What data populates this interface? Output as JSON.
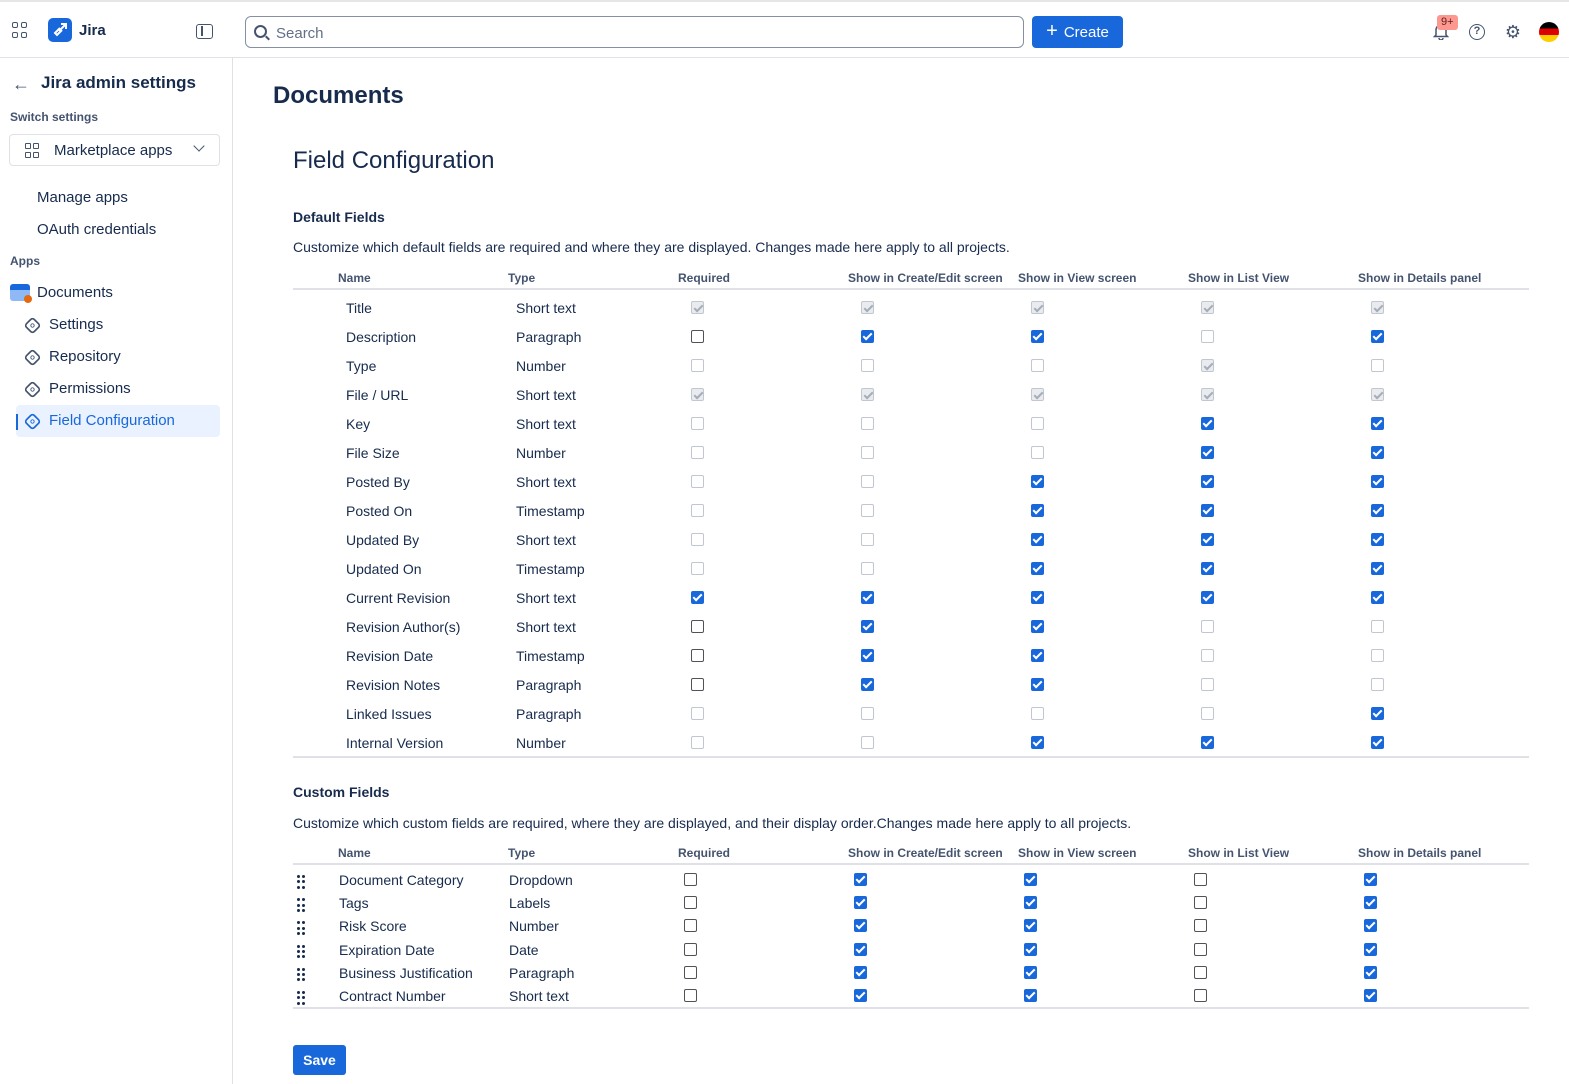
{
  "topbar": {
    "brand": "Jira",
    "search_placeholder": "Search",
    "create_label": "Create",
    "notifications_badge": "9+"
  },
  "sidebar": {
    "title": "Jira admin settings",
    "switch_label": "Switch settings",
    "switch_value": "Marketplace apps",
    "links": [
      "Manage apps",
      "OAuth credentials"
    ],
    "apps_label": "Apps",
    "app_name": "Documents",
    "app_items": [
      "Settings",
      "Repository",
      "Permissions",
      "Field Configuration"
    ],
    "active_item": "Field Configuration"
  },
  "main": {
    "page_title": "Documents",
    "section_title": "Field Configuration",
    "columns": [
      "Name",
      "Type",
      "Required",
      "Show in Create/Edit screen",
      "Show in View screen",
      "Show in List View",
      "Show in Details panel"
    ],
    "default_fields": {
      "title": "Default Fields",
      "description": "Customize which default fields are required and where they are displayed. Changes made here apply to all projects.",
      "rows": [
        {
          "name": "Title",
          "type": "Short text",
          "flags": [
            "dc",
            "dc",
            "dc",
            "dc",
            "dc"
          ]
        },
        {
          "name": "Description",
          "type": "Paragraph",
          "flags": [
            "u",
            "c",
            "c",
            "du",
            "c"
          ]
        },
        {
          "name": "Type",
          "type": "Number",
          "flags": [
            "du",
            "du",
            "du",
            "dc",
            "du"
          ]
        },
        {
          "name": "File / URL",
          "type": "Short text",
          "flags": [
            "dc",
            "dc",
            "dc",
            "dc",
            "dc"
          ]
        },
        {
          "name": "Key",
          "type": "Short text",
          "flags": [
            "du",
            "du",
            "du",
            "c",
            "c"
          ]
        },
        {
          "name": "File Size",
          "type": "Number",
          "flags": [
            "du",
            "du",
            "du",
            "c",
            "c"
          ]
        },
        {
          "name": "Posted By",
          "type": "Short text",
          "flags": [
            "du",
            "du",
            "c",
            "c",
            "c"
          ]
        },
        {
          "name": "Posted On",
          "type": "Timestamp",
          "flags": [
            "du",
            "du",
            "c",
            "c",
            "c"
          ]
        },
        {
          "name": "Updated By",
          "type": "Short text",
          "flags": [
            "du",
            "du",
            "c",
            "c",
            "c"
          ]
        },
        {
          "name": "Updated On",
          "type": "Timestamp",
          "flags": [
            "du",
            "du",
            "c",
            "c",
            "c"
          ]
        },
        {
          "name": "Current Revision",
          "type": "Short text",
          "flags": [
            "c",
            "c",
            "c",
            "c",
            "c"
          ]
        },
        {
          "name": "Revision Author(s)",
          "type": "Short text",
          "flags": [
            "u",
            "c",
            "c",
            "du",
            "du"
          ]
        },
        {
          "name": "Revision Date",
          "type": "Timestamp",
          "flags": [
            "u",
            "c",
            "c",
            "du",
            "du"
          ]
        },
        {
          "name": "Revision Notes",
          "type": "Paragraph",
          "flags": [
            "u",
            "c",
            "c",
            "du",
            "du"
          ]
        },
        {
          "name": "Linked Issues",
          "type": "Paragraph",
          "flags": [
            "du",
            "du",
            "du",
            "du",
            "c"
          ]
        },
        {
          "name": "Internal Version",
          "type": "Number",
          "flags": [
            "du",
            "du",
            "c",
            "c",
            "c"
          ]
        }
      ]
    },
    "custom_fields": {
      "title": "Custom Fields",
      "description": "Customize which custom fields are required, where they are displayed, and their display order.Changes made here apply to all projects.",
      "rows": [
        {
          "name": "Document Category",
          "type": "Dropdown",
          "flags": [
            "u",
            "c",
            "c",
            "u",
            "c"
          ]
        },
        {
          "name": "Tags",
          "type": "Labels",
          "flags": [
            "u",
            "c",
            "c",
            "u",
            "c"
          ]
        },
        {
          "name": "Risk Score",
          "type": "Number",
          "flags": [
            "u",
            "c",
            "c",
            "u",
            "c"
          ]
        },
        {
          "name": "Expiration Date",
          "type": "Date",
          "flags": [
            "u",
            "c",
            "c",
            "u",
            "c"
          ]
        },
        {
          "name": "Business Justification",
          "type": "Paragraph",
          "flags": [
            "u",
            "c",
            "c",
            "u",
            "c"
          ]
        },
        {
          "name": "Contract Number",
          "type": "Short text",
          "flags": [
            "u",
            "c",
            "c",
            "u",
            "c"
          ]
        }
      ]
    },
    "save_label": "Save"
  }
}
